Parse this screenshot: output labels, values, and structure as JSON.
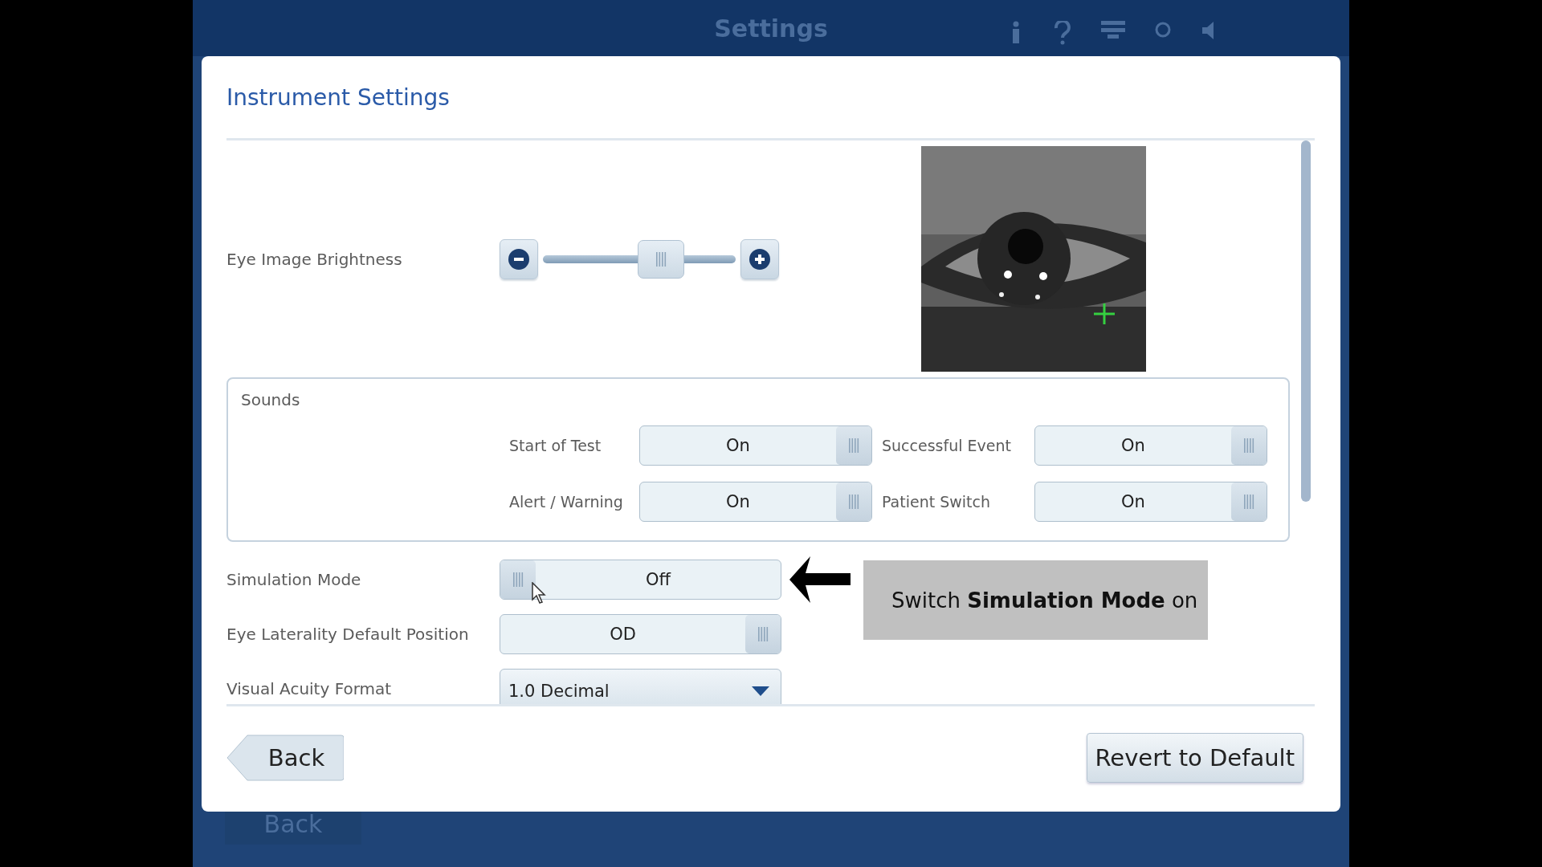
{
  "background": {
    "title": "Settings",
    "back_button": "Back"
  },
  "dialog": {
    "title": "Instrument Settings",
    "brightness": {
      "label": "Eye Image Brightness",
      "level": 0.65
    },
    "sounds": {
      "title": "Sounds",
      "items": [
        {
          "label": "Start of Test",
          "value": "On",
          "thumb_right": true
        },
        {
          "label": "Successful Event",
          "value": "On",
          "thumb_right": true
        },
        {
          "label": "Alert / Warning",
          "value": "On",
          "thumb_right": true
        },
        {
          "label": "Patient Switch",
          "value": "On",
          "thumb_right": true
        }
      ]
    },
    "simulation_mode": {
      "label": "Simulation Mode",
      "value": "Off",
      "thumb_right": false
    },
    "eye_laterality": {
      "label": "Eye Laterality Default Position",
      "value": "OD",
      "thumb_right": true
    },
    "visual_acuity_format": {
      "label": "Visual Acuity Format",
      "value": "1.0 Decimal"
    },
    "callout": {
      "text": "Switch **Simulation Mode** on"
    },
    "buttons": {
      "back": "Back",
      "revert": "Revert to Default"
    }
  }
}
